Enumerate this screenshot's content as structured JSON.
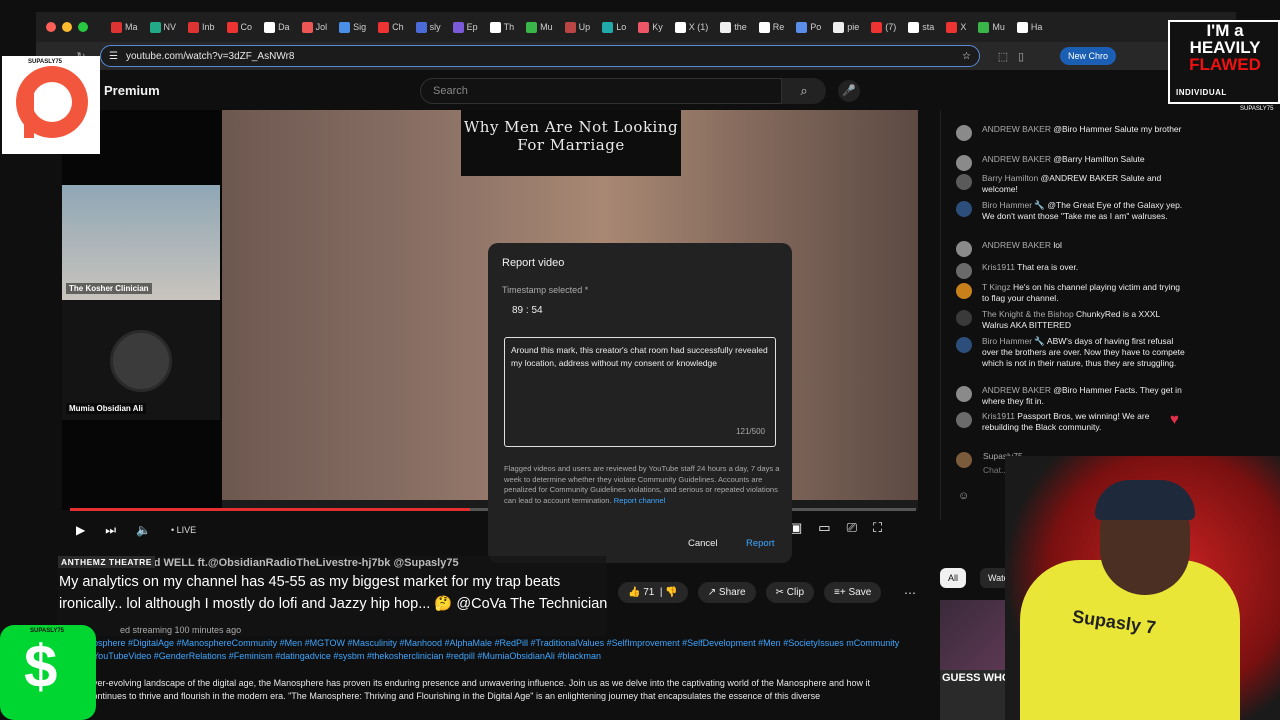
{
  "browser": {
    "tabs": [
      "Ma",
      "NV",
      "Inb",
      "Co",
      "Da",
      "Jol",
      "Sig",
      "Ch",
      "sly",
      "Ep",
      "Th",
      "Mu",
      "Up",
      "Lo",
      "Ky",
      "X (1)",
      "the",
      "Re",
      "Po",
      "pie",
      "(7)",
      "sta",
      "X",
      "Mu",
      "Ha"
    ],
    "url": "youtube.com/watch?v=3dZF_AsNWr8",
    "new_chrome_label": "New Chro"
  },
  "youtube": {
    "premium_label": "Premium",
    "search_placeholder": "Search"
  },
  "video": {
    "thumbnail_title": "Why Men Are Not Looking For Marriage",
    "cam1_label": "The Kosher Clinician",
    "cam2_label": "Mumia Obsidian Ali",
    "live_label": "• LIVE"
  },
  "dialog": {
    "title": "Report video",
    "timestamp_label": "Timestamp selected *",
    "timestamp_min": "89",
    "timestamp_sec": "54",
    "textarea_value": "Around this mark, this creator's chat room had successfully revealed my location, address without my consent or knowledge",
    "char_counter": "121/500",
    "disclaimer": "Flagged videos and users are reviewed by YouTube staff 24 hours a day, 7 days a week to determine whether they violate Community Guidelines. Accounts are penalized for Community Guidelines violations, and serious or repeated violations can lead to account termination.",
    "report_channel_link": "Report channel",
    "cancel_label": "Cancel",
    "report_label": "Report"
  },
  "chat": {
    "messages": [
      {
        "author": "ANDREW BAKER",
        "text": "@Biro Hammer Salute my brother",
        "color": "#8a8a8a"
      },
      {
        "author": "ANDREW BAKER",
        "text": "@Barry Hamilton Salute",
        "color": "#8a8a8a"
      },
      {
        "author": "Barry Hamilton",
        "text": "@ANDREW BAKER Salute and welcome!",
        "color": "#5a5a5a"
      },
      {
        "author": "Biro Hammer 🔧",
        "text": "@The Great Eye of the Galaxy yep. We don't want those \"Take me as I am\" walruses.",
        "color": "#2d4e7a"
      },
      {
        "author": "ANDREW BAKER",
        "text": "lol",
        "color": "#8a8a8a"
      },
      {
        "author": "Kris1911",
        "text": "That era is over.",
        "color": "#6a6a6a"
      },
      {
        "author": "T Kingz",
        "text": "He's on his channel playing victim and trying to flag your channel.",
        "color": "#c8801a"
      },
      {
        "author": "The Knight & the Bishop",
        "text": "ChunkyRed is a XXXL Walrus AKA BITTERED",
        "color": "#3a3a3a"
      },
      {
        "author": "Biro Hammer 🔧",
        "text": "ABW's days of having first refusal over the brothers are over. Now they have to compete which is not in their nature, thus they are struggling.",
        "color": "#2d4e7a"
      },
      {
        "author": "ANDREW BAKER",
        "text": "@Biro Hammer Facts. They get in where they fit in.",
        "color": "#8a8a8a"
      },
      {
        "author": "Kris1911",
        "text": "Passport Bros, we winning! We are rebuilding the Black community.",
        "color": "#6a6a6a"
      }
    ],
    "input_author": "Supasly75",
    "input_placeholder": "Chat..."
  },
  "below_video": {
    "ticker": "HERE Is ALIVE and WELL ft.@ObsidianRadioTheLivestre-hj7bk @Supasly75",
    "overlay_badge": "ANTHEMZ THEATRE",
    "overlay_message": "My analytics on my channel has 45-55 as my biggest market for my trap beats ironically.. lol although I mostly do lofi and Jazzy hip hop... 🤔 @CoVa The Technician",
    "like_count": "71",
    "share_label": "Share",
    "clip_label": "Clip",
    "save_label": "Save",
    "streamed": "ed streaming 100 minutes ago",
    "hashtags": "nosphere #DigitalAge #ManosphereCommunity #Men #MGTOW #Masculinity #Manhood #AlphaMale #RedPill #TraditionalValues #SelfImprovement #SelfDevelopment #Men #SocietyIssues mCommunity #YouTubeVideo #GenderRelations #Feminism #datingadvice #sysbm #thekosherclinician #redpill #MumiaObsidianAli #blackman",
    "description": "ever-evolving landscape of the digital age, the Manosphere has proven its enduring presence and unwavering influence. Join us as we delve into the captivating world of the Manosphere and how it continues to thrive and flourish in the modern era. \"The Manosphere: Thriving and Flourishing in the Digital Age\" is an enlightening journey that encapsulates the essence of this diverse"
  },
  "sidebar_right": {
    "chip_all": "All",
    "chip_watched": "Watche",
    "rec_title": "GUESS WHO'S DEFENDING"
  },
  "overlays": {
    "streamer_shirt": "Supasly 7",
    "patreon_label": "SUPASLY75",
    "cashapp_label": "SUPASLY75",
    "logo_line1": "I'M a",
    "logo_line2": "HEAVILY",
    "logo_line3": "FLAWED",
    "logo_line4": "INDIVIDUAL",
    "logo_handle": "SUPASLY75"
  }
}
